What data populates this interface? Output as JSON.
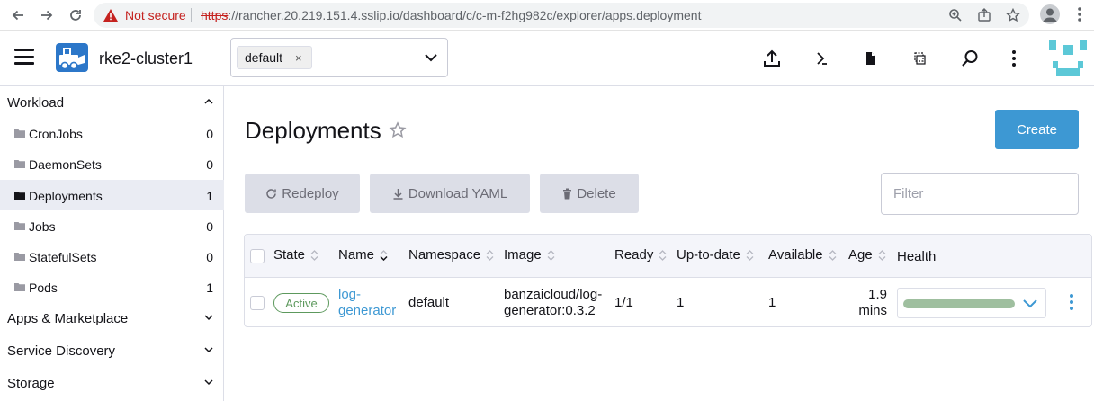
{
  "browser": {
    "security_label": "Not secure",
    "url_scheme": "https",
    "url_rest": "://rancher.20.219.151.4.sslip.io/dashboard/c/c-m-f2hg982c/explorer/apps.deployment"
  },
  "header": {
    "cluster_name": "rke2-cluster1",
    "namespace_tag": "default",
    "namespace_remove": "×"
  },
  "sidebar": {
    "groups": [
      {
        "label": "Workload"
      },
      {
        "label": "Apps & Marketplace"
      },
      {
        "label": "Service Discovery"
      },
      {
        "label": "Storage"
      }
    ],
    "items": [
      {
        "label": "CronJobs",
        "count": "0"
      },
      {
        "label": "DaemonSets",
        "count": "0"
      },
      {
        "label": "Deployments",
        "count": "1"
      },
      {
        "label": "Jobs",
        "count": "0"
      },
      {
        "label": "StatefulSets",
        "count": "0"
      },
      {
        "label": "Pods",
        "count": "1"
      }
    ]
  },
  "main": {
    "title": "Deployments",
    "create_label": "Create",
    "redeploy_label": "Redeploy",
    "download_label": "Download YAML",
    "delete_label": "Delete",
    "filter_placeholder": "Filter",
    "columns": [
      "State",
      "Name",
      "Namespace",
      "Image",
      "Ready",
      "Up-to-date",
      "Available",
      "Age",
      "Health"
    ],
    "rows": [
      {
        "state": "Active",
        "name_line1": "log-",
        "name_line2": "generator",
        "namespace": "default",
        "image_line1": "banzaicloud/log-",
        "image_line2": "generator:0.3.2",
        "ready": "1/1",
        "up_to_date": "1",
        "available": "1",
        "age_line1": "1.9",
        "age_line2": "mins",
        "health_fraction": 1.0
      }
    ]
  },
  "colors": {
    "primary": "#3d98d3",
    "active_green": "#5d995d",
    "health_bar": "#9fbf9f",
    "warning_red": "#c5221f"
  }
}
